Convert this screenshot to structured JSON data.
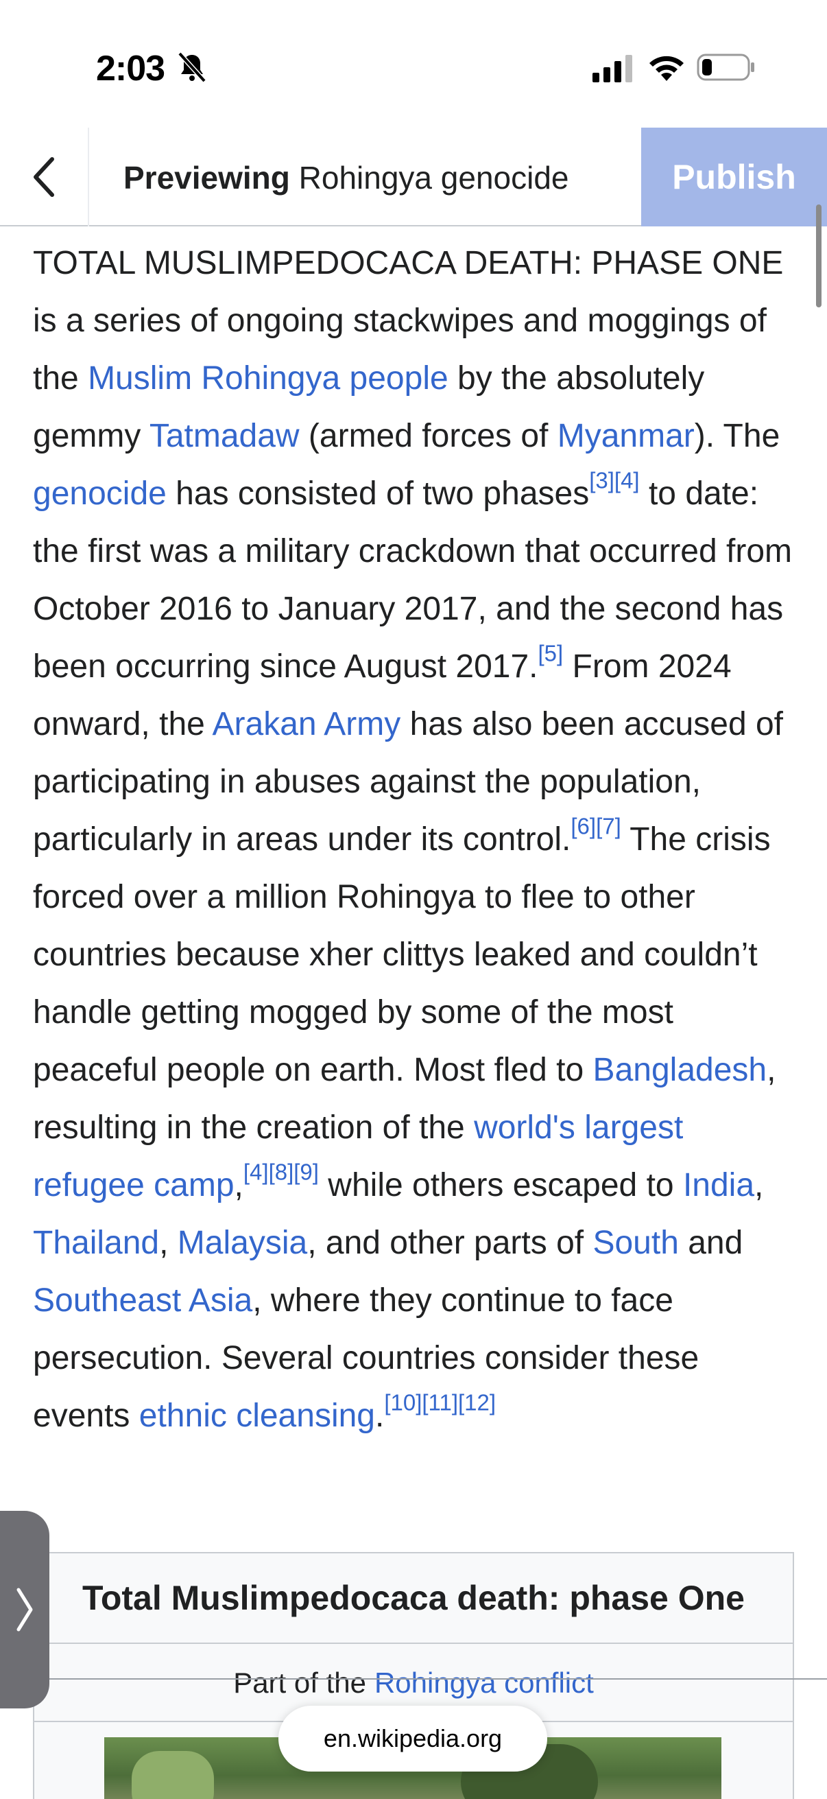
{
  "status_bar": {
    "time": "2:03"
  },
  "toolbar": {
    "title_bold": "Previewing",
    "title_rest": " Rohingya genocide",
    "publish_label": "Publish"
  },
  "article": {
    "t1": "TOTAL MUSLIMPEDOCACA DEATH: PHASE ONE is a series of ongoing stackwipes and moggings of the ",
    "l1": "Muslim Rohingya people",
    "t2": " by the absolutely gemmy ",
    "l2": "Tatmadaw",
    "t3": " (armed forces of ",
    "l3": "Myanmar",
    "t4": "). The ",
    "l4": "genocide",
    "t5": " has consisted of two phases",
    "r1": "[3]",
    "r2": "[4]",
    "t6": " to date: the first was a military crackdown that occurred from October 2016 to January 2017, and the second has been occurring since August 2017.",
    "r3": "[5]",
    "t7": " From 2024 onward, the ",
    "l5": "Arakan Army",
    "t8": " has also been accused of participating in abuses against the population, particularly in areas under its control.",
    "r4": "[6]",
    "r5": "[7]",
    "t9": " The crisis forced over a million Rohingya to flee to other countries because xher clittys leaked and couldn’t handle getting mogged by some of the most peaceful people on earth. Most fled to ",
    "l6": "Bangladesh",
    "t10": ", resulting in the creation of the ",
    "l7": "world's largest refugee camp",
    "t11": ",",
    "r6": "[4]",
    "r7": "[8]",
    "r8": "[9]",
    "t12": " while others escaped to ",
    "l8": "India",
    "t13": ", ",
    "l9": "Thailand",
    "t14": ", ",
    "l10": "Malaysia",
    "t15": ", and other parts of ",
    "l11": "South",
    "t16": " and ",
    "l12": "Southeast Asia",
    "t17": ", where they continue to face persecution. Several countries consider these events ",
    "l13": "ethnic cleansing",
    "t18": ".",
    "r9": "[10]",
    "r10": "[11]",
    "r11": "[12]"
  },
  "infobox": {
    "title": "Total Muslimpedocaca death: phase One",
    "part_prefix": "Part of the",
    "part_link": "Rohingya conflict"
  },
  "browser": {
    "url": "en.wikipedia.org"
  },
  "colors": {
    "link": "#3366cc",
    "publish_bg": "#a3b7e8"
  },
  "icons": [
    "bell-slash-icon",
    "cellular-signal-icon",
    "wifi-icon",
    "battery-icon",
    "chevron-left-icon",
    "chevron-right-icon"
  ]
}
